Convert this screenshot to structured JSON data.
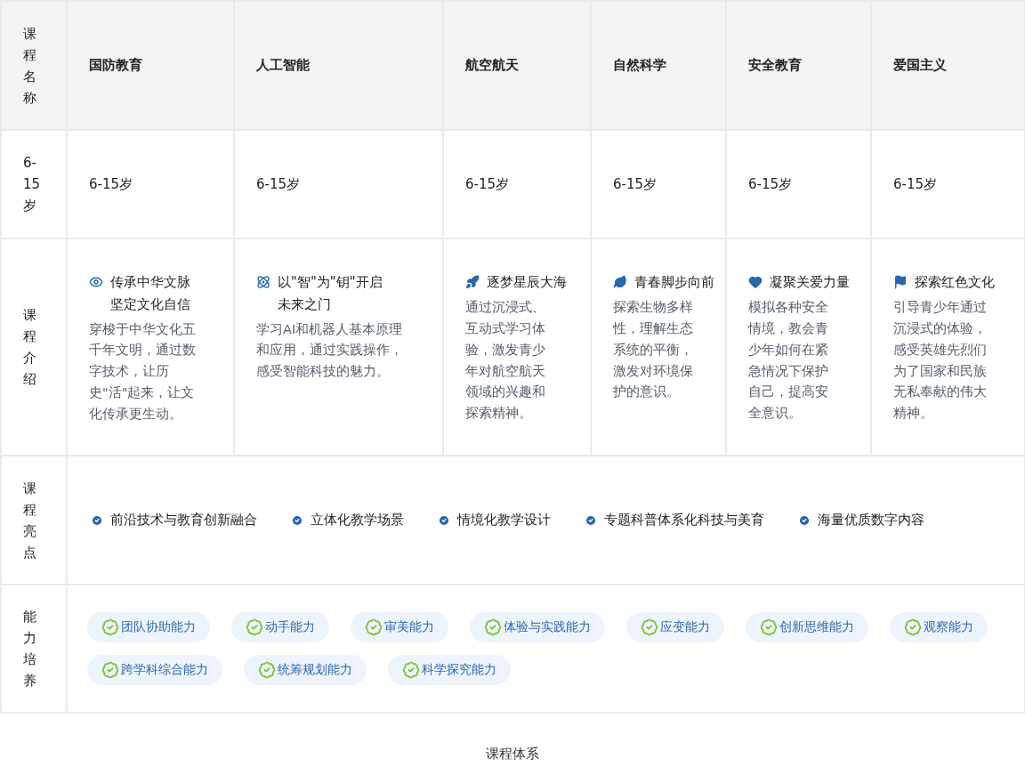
{
  "row_labels": [
    "课程名称",
    "6-15岁",
    "课程介绍",
    "课程亮点",
    "能力培养"
  ],
  "courses": [
    {
      "name": "国防教育",
      "age": "6-15岁",
      "title_lines": [
        "传承中华文脉",
        "坚定文化自信"
      ],
      "description": "穿梭于中华文化五千年文明，通过数字技术，让历史\"活\"起来，让文化传承更生动。"
    },
    {
      "name": "人工智能",
      "age": "6-15岁",
      "title_lines": [
        "以\"智\"为\"钥\"开启",
        "未来之门"
      ],
      "description": "学习AI和机器人基本原理和应用，通过实践操作，感受智能科技的魅力。"
    },
    {
      "name": "航空航天",
      "age": "6-15岁",
      "title_lines": [
        "逐梦星辰大海"
      ],
      "description": "通过沉浸式、互动式学习体验，激发青少年对航空航天领域的兴趣和探索精神。"
    },
    {
      "name": "自然科学",
      "age": "6-15岁",
      "title_lines": [
        "青春脚步向前"
      ],
      "description": "探索生物多样性，理解生态系统的平衡，激发对环境保护的意识。"
    },
    {
      "name": "安全教育",
      "age": "6-15岁",
      "title_lines": [
        "凝聚关爱力量"
      ],
      "description": "模拟各种安全情境，教会青少年如何在紧急情况下保护自己，提高安全意识。"
    },
    {
      "name": "爱国主义",
      "age": "6-15岁",
      "title_lines": [
        "探索红色文化"
      ],
      "description": "引导青少年通过沉浸式的体验，感受英雄先烈们为了国家和民族无私奉献的伟大精神。"
    }
  ],
  "highlights": [
    "前沿技术与教育创新融合",
    "立体化教学场景",
    "情境化教学设计",
    "专题科普体系化科技与美育",
    "海量优质数字内容"
  ],
  "abilities": [
    "团队协助能力",
    "动手能力",
    "审美能力",
    "体验与实践能力",
    "应变能力",
    "创新思维能力",
    "观察能力",
    "跨学科综合能力",
    "统筹规划能力",
    "科学探究能力"
  ],
  "caption": "课程体系"
}
